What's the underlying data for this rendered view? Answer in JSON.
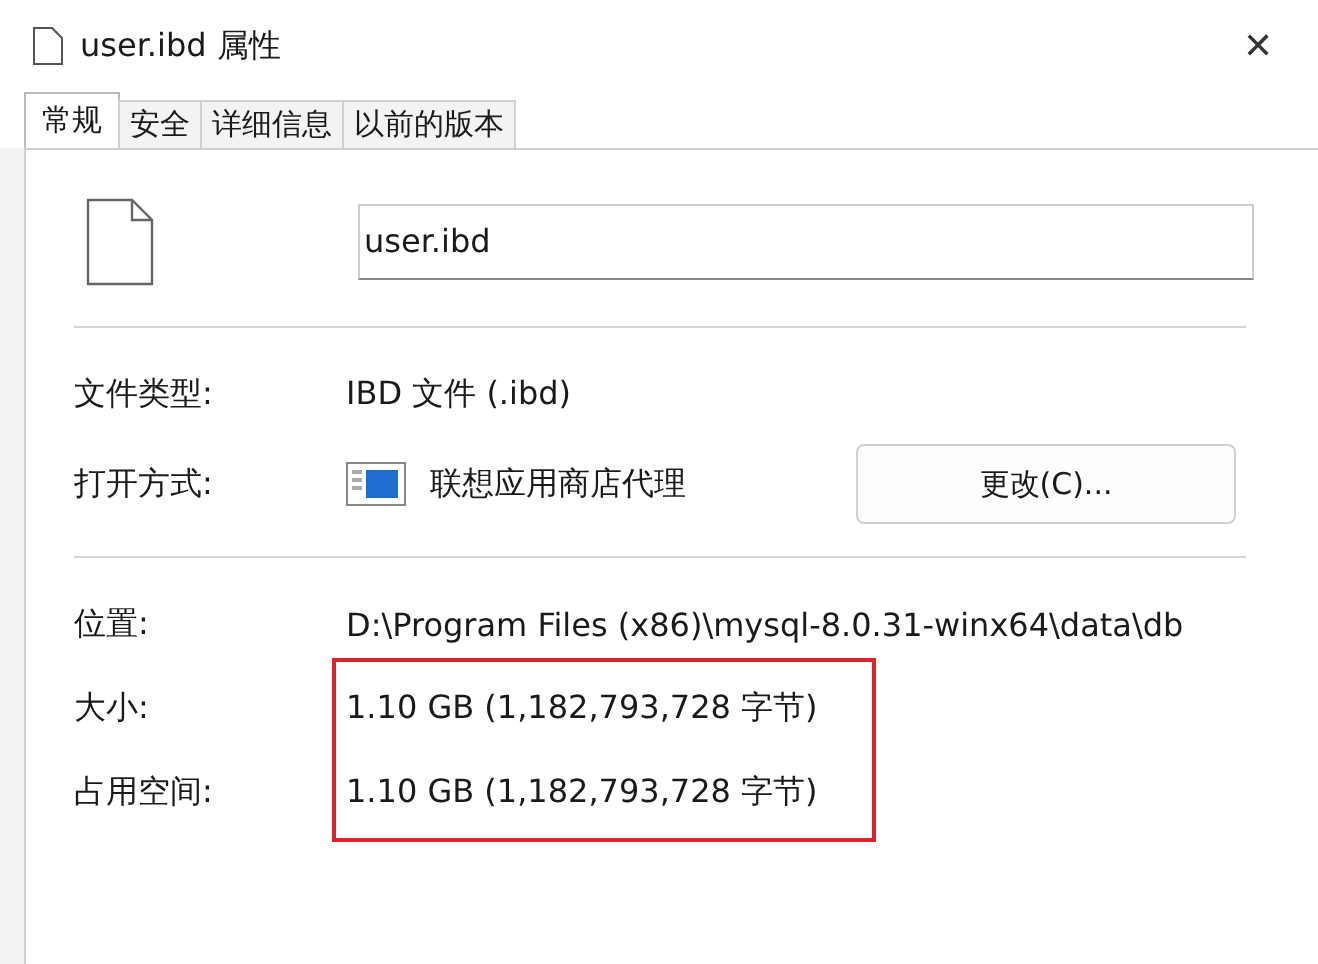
{
  "window": {
    "title": "user.ibd 属性",
    "close": "✕"
  },
  "tabs": [
    {
      "label": "常规",
      "selected": true
    },
    {
      "label": "安全",
      "selected": false
    },
    {
      "label": "详细信息",
      "selected": false
    },
    {
      "label": "以前的版本",
      "selected": false
    }
  ],
  "file_name": "user.ibd",
  "rows": [
    {
      "kind": "text",
      "label": "文件类型:",
      "value": "IBD 文件 (.ibd)"
    },
    {
      "kind": "app",
      "label": "打开方式:",
      "value": "联想应用商店代理",
      "button": "更改(C)..."
    },
    {
      "kind": "divider"
    },
    {
      "kind": "text",
      "label": "位置:",
      "value": "D:\\Program Files (x86)\\mysql-8.0.31-winx64\\data\\db"
    },
    {
      "kind": "text",
      "label": "大小:",
      "value": "1.10 GB (1,182,793,728 字节)"
    },
    {
      "kind": "text",
      "label": "占用空间:",
      "value": "1.10 GB (1,182,793,728 字节)"
    }
  ]
}
